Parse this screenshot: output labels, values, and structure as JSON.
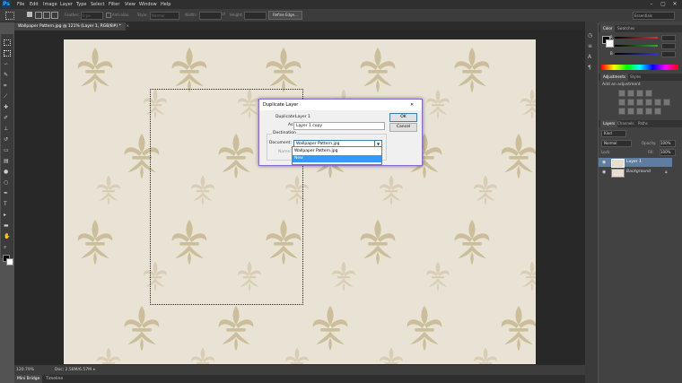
{
  "app": {
    "logo": "Ps"
  },
  "menu": [
    "File",
    "Edit",
    "Image",
    "Layer",
    "Type",
    "Select",
    "Filter",
    "View",
    "Window",
    "Help"
  ],
  "window_controls": [
    "–",
    "▢",
    "✕"
  ],
  "options_bar": {
    "feather_label": "Feather:",
    "feather_value": "0 px",
    "antialias_label": "Anti-alias",
    "style_label": "Style:",
    "style_value": "Normal",
    "width_label": "Width:",
    "height_label": "Height:",
    "refine_edge": "Refine Edge...",
    "workspace": "Essentials"
  },
  "document_tab": {
    "title": "Wallpaper Pattern.jpg @ 121% (Layer 1, RGB/8#) *",
    "close": "×"
  },
  "status": {
    "zoom": "120.79%",
    "doc": "Doc: 2.58M/6.57M"
  },
  "bottom_tabs": [
    "Mini Bridge",
    "Timeline"
  ],
  "color_panel": {
    "tabs": [
      "Color",
      "Swatches"
    ],
    "labels": [
      "R",
      "G",
      "B"
    ],
    "values": [
      "",
      "",
      ""
    ],
    "accent_colors": {
      "r": "#d33",
      "g": "#3a3",
      "b": "#33d"
    }
  },
  "adjustments_panel": {
    "tabs": [
      "Adjustments",
      "Styles"
    ],
    "heading": "Add an adjustment"
  },
  "layers_panel": {
    "tabs": [
      "Layers",
      "Channels",
      "Paths"
    ],
    "kind_label": "Kind",
    "blend_mode": "Normal",
    "opacity_label": "Opacity:",
    "opacity_value": "100%",
    "lock_label": "Lock:",
    "fill_label": "Fill:",
    "fill_value": "100%",
    "layers": [
      {
        "name": "Layer 1",
        "selected": true
      },
      {
        "name": "Background",
        "selected": false
      }
    ]
  },
  "dialog": {
    "title": "Duplicate Layer",
    "close": "✕",
    "duplicate_label": "Duplicate:",
    "duplicate_value": "Layer 1",
    "as_label": "As:",
    "as_value": "Layer 1 copy",
    "destination_label": "Destination",
    "document_label": "Document:",
    "document_value": "Wallpaper Pattern.jpg",
    "name_label": "Name:",
    "ok": "OK",
    "cancel": "Cancel",
    "dropdown_options": [
      "Wallpaper Pattern.jpg",
      "New"
    ],
    "dropdown_highlight": "#3399ff"
  }
}
